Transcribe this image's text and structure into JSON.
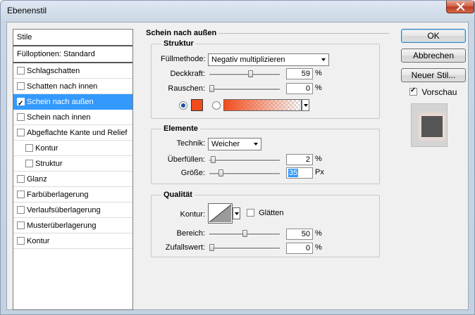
{
  "window": {
    "title": "Ebenenstil"
  },
  "stile": {
    "header": "Stile",
    "fuelloptionen": "Fülloptionen: Standard",
    "items": [
      {
        "label": "Schlagschatten",
        "checked": false,
        "selected": false,
        "sub": false
      },
      {
        "label": "Schatten nach innen",
        "checked": false,
        "selected": false,
        "sub": false
      },
      {
        "label": "Schein nach außen",
        "checked": true,
        "selected": true,
        "sub": false
      },
      {
        "label": "Schein nach innen",
        "checked": false,
        "selected": false,
        "sub": false
      },
      {
        "label": "Abgeflachte Kante und Relief",
        "checked": false,
        "selected": false,
        "sub": false
      },
      {
        "label": "Kontur",
        "checked": false,
        "selected": false,
        "sub": true
      },
      {
        "label": "Struktur",
        "checked": false,
        "selected": false,
        "sub": true
      },
      {
        "label": "Glanz",
        "checked": false,
        "selected": false,
        "sub": false
      },
      {
        "label": "Farbüberlagerung",
        "checked": false,
        "selected": false,
        "sub": false
      },
      {
        "label": "Verlaufsüberlagerung",
        "checked": false,
        "selected": false,
        "sub": false
      },
      {
        "label": "Musterüberlagerung",
        "checked": false,
        "selected": false,
        "sub": false
      },
      {
        "label": "Kontur",
        "checked": false,
        "selected": false,
        "sub": false
      }
    ]
  },
  "main": {
    "title": "Schein nach außen",
    "struktur": {
      "title": "Struktur",
      "fuellmethode_label": "Füllmethode:",
      "fuellmethode_value": "Negativ multiplizieren",
      "deckkraft_label": "Deckkraft:",
      "deckkraft_value": "59",
      "deckkraft_unit": "%",
      "deckkraft_level": 0.59,
      "rauschen_label": "Rauschen:",
      "rauschen_value": "0",
      "rauschen_unit": "%",
      "rauschen_level": 0,
      "color": "#f24c1c",
      "color_mode": "solid"
    },
    "elemente": {
      "title": "Elemente",
      "technik_label": "Technik:",
      "technik_value": "Weicher",
      "ueberfuellen_label": "Überfüllen:",
      "ueberfuellen_value": "2",
      "ueberfuellen_unit": "%",
      "ueberfuellen_level": 0.02,
      "groesse_label": "Größe:",
      "groesse_value": "35",
      "groesse_unit": "Px",
      "groesse_level": 0.14
    },
    "qualitaet": {
      "title": "Qualität",
      "kontur_label": "Kontur:",
      "glaetten_label": "Glätten",
      "glaetten_checked": false,
      "bereich_label": "Bereich:",
      "bereich_value": "50",
      "bereich_unit": "%",
      "bereich_level": 0.5,
      "zufallswert_label": "Zufallswert:",
      "zufallswert_value": "0",
      "zufallswert_unit": "%",
      "zufallswert_level": 0
    }
  },
  "buttons": {
    "ok": "OK",
    "abbrechen": "Abbrechen",
    "neuer_stil": "Neuer Stil...",
    "vorschau_label": "Vorschau",
    "vorschau_checked": true
  }
}
